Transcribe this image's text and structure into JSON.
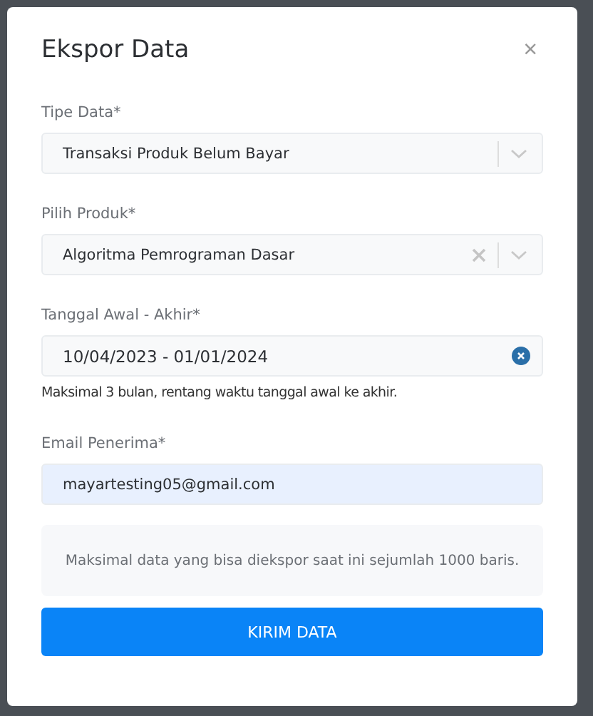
{
  "dialog": {
    "title": "Ekspor Data",
    "close": "×"
  },
  "fields": [
    {
      "kind": "select",
      "label": "Tipe Data*",
      "value": "Transaksi Produk Belum Bayar",
      "clearable": false
    },
    {
      "kind": "select",
      "label": "Pilih Produk*",
      "value": "Algoritma Pemrograman Dasar",
      "clearable": true
    },
    {
      "kind": "date",
      "label": "Tanggal Awal - Akhir*",
      "value": "10/04/2023 - 01/01/2024",
      "clearable": true,
      "hint": "Maksimal 3 bulan, rentang waktu tanggal awal ke akhir."
    },
    {
      "kind": "text",
      "label": "Email Penerima*",
      "value": "mayartesting05@gmail.com",
      "autofilled": true
    }
  ],
  "notice": "Maksimal data yang bisa diekspor saat ini sejumlah 1000 baris.",
  "submit": "KIRIM DATA"
}
